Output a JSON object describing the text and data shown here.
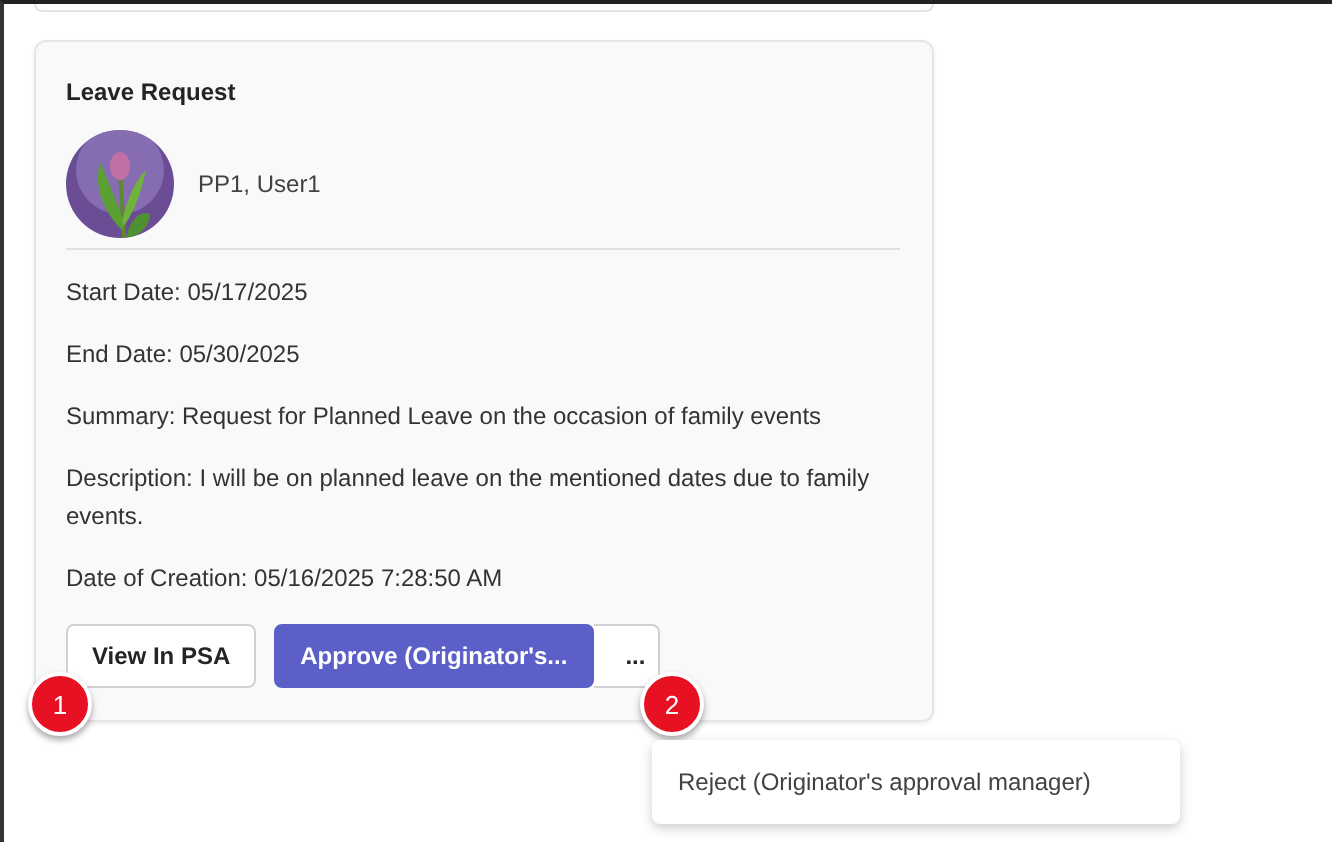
{
  "card": {
    "title": "Leave Request",
    "requester": {
      "name": "PP1, User1"
    },
    "details": [
      "Start Date: 05/17/2025",
      "End Date: 05/30/2025",
      "Summary: Request for Planned Leave on the occasion of family events",
      "Description: I will be on planned leave on the mentioned dates due to family events.",
      "Date of Creation: 05/16/2025 7:28:50 AM"
    ],
    "actions": [
      {
        "label": "View In PSA",
        "kind": "secondary"
      },
      {
        "label": "Approve (Originator's...",
        "kind": "primary"
      },
      {
        "label": "...",
        "kind": "more"
      }
    ]
  },
  "step_badges": [
    "1",
    "2"
  ],
  "menu": {
    "items": [
      "Reject (Originator's approval manager)"
    ]
  }
}
